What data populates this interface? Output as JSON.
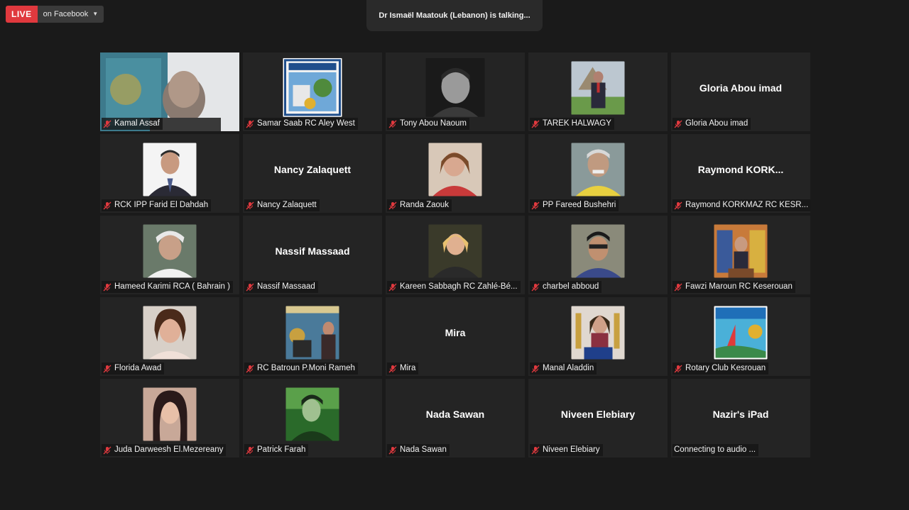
{
  "toolbar": {
    "live_label": "LIVE",
    "stream_target": "on Facebook"
  },
  "status": {
    "talking_text": "Dr Ismaël Maatouk (Lebanon) is talking..."
  },
  "participants": [
    {
      "label": "Kamal Assaf"
    },
    {
      "label": "Samar Saab RC Aley West"
    },
    {
      "label": "Tony Abou Naoum"
    },
    {
      "label": "TAREK HALWAGY"
    },
    {
      "label": "Gloria Abou imad",
      "center": "Gloria Abou imad"
    },
    {
      "label": "RCK IPP Farid El Dahdah"
    },
    {
      "label": "Nancy Zalaquett",
      "center": "Nancy Zalaquett"
    },
    {
      "label": "Randa Zaouk"
    },
    {
      "label": "PP Fareed Bushehri"
    },
    {
      "label": "Raymond KORKMAZ RC KESR...",
      "center": "Raymond  KORK..."
    },
    {
      "label": "Hameed Karimi RCA ( Bahrain )"
    },
    {
      "label": "Nassif Massaad",
      "center": "Nassif Massaad"
    },
    {
      "label": "Kareen Sabbagh RC Zahlé-Bé..."
    },
    {
      "label": "charbel abboud"
    },
    {
      "label": "Fawzi Maroun RC Keserouan"
    },
    {
      "label": "Florida Awad"
    },
    {
      "label": "RC Batroun P.Moni Rameh"
    },
    {
      "label": "Mira",
      "center": "Mira"
    },
    {
      "label": "Manal Aladdin"
    },
    {
      "label": "Rotary Club Kesrouan"
    },
    {
      "label": "Juda Darweesh El.Mezereany"
    },
    {
      "label": "Patrick Farah"
    },
    {
      "label": "Nada Sawan",
      "center": "Nada Sawan"
    },
    {
      "label": "Niveen Elebiary",
      "center": "Niveen Elebiary"
    },
    {
      "label": "Connecting to audio ...",
      "center": "Nazir's iPad"
    }
  ],
  "colors": {
    "live_red": "#e0393e",
    "muted_red": "#e0393e",
    "background": "#1a1a1a",
    "tile": "#242424"
  }
}
